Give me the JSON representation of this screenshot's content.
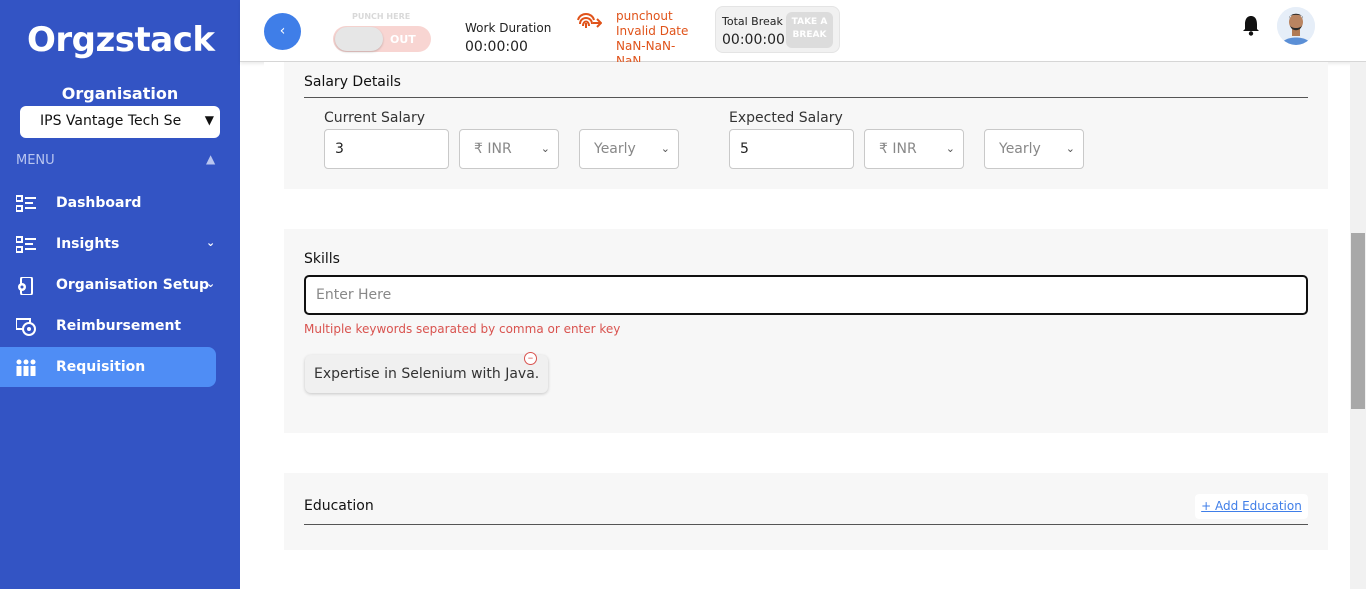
{
  "sidebar": {
    "logo": "Orgzstack",
    "org_label": "Organisation",
    "org_selected": "IPS Vantage Tech Se",
    "menu_label": "MENU",
    "items": [
      {
        "label": "Dashboard",
        "icon": "list-icon"
      },
      {
        "label": "Insights",
        "icon": "list-icon"
      },
      {
        "label": "Organisation Setup",
        "icon": "device-settings-icon"
      },
      {
        "label": "Reimbursement",
        "icon": "money-refund-icon"
      },
      {
        "label": "Requisition",
        "icon": "people-group-icon"
      }
    ]
  },
  "header": {
    "punch_here_label": "PUNCH HERE",
    "punch_state": "OUT",
    "work_duration_label": "Work Duration",
    "work_duration_value": "00:00:00",
    "punch_status_line1": "punchout",
    "punch_status_line2": "Invalid Date",
    "punch_status_line3": "NaN-NaN-",
    "punch_status_line4": "NaN",
    "total_break_label": "Total Break",
    "total_break_value": "00:00:00",
    "take_break_label": "TAKE A BREAK"
  },
  "salary": {
    "title": "Salary Details",
    "current_label": "Current Salary",
    "current_value": "3",
    "current_currency": "₹ INR",
    "current_period": "Yearly",
    "expected_label": "Expected Salary",
    "expected_value": "5",
    "expected_currency": "₹ INR",
    "expected_period": "Yearly"
  },
  "skills": {
    "title": "Skills",
    "placeholder": "Enter Here",
    "hint": "Multiple keywords separated by comma or enter key",
    "chips": [
      "Expertise in Selenium with Java."
    ]
  },
  "education": {
    "title": "Education",
    "add_label": "+ Add Education"
  },
  "colors": {
    "sidebar_bg": "#3354c4",
    "active_item": "#4f8df5",
    "accent": "#3f7ee8",
    "error": "#d9534f",
    "punch_status": "#e0531a"
  }
}
